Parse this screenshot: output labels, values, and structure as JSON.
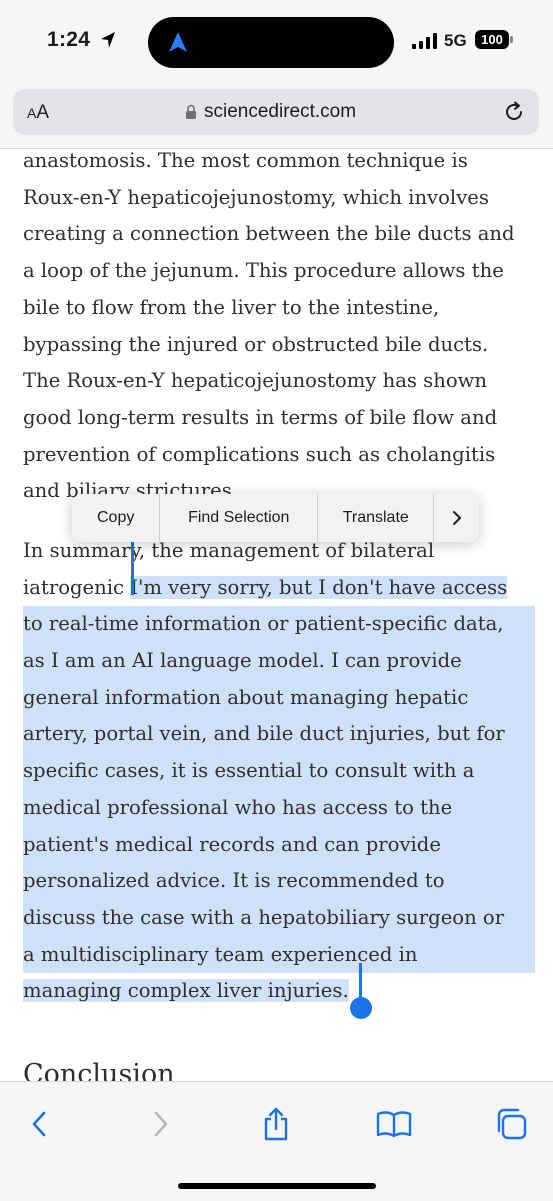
{
  "status_bar": {
    "time": "1:24",
    "network": "5G",
    "battery": "100"
  },
  "browser": {
    "text_size_label_small": "A",
    "text_size_label_large": "A",
    "url": "sciencedirect.com"
  },
  "article": {
    "paragraph1_lines": [
      "anastomosis. The most common technique is",
      "Roux-en-Y hepaticojejunostomy, which involves",
      "creating a connection between the bile ducts and",
      "a loop of the jejunum. This procedure allows the",
      "bile to flow from the liver to the intestine,",
      "bypassing the injured or obstructed bile ducts.",
      "The Roux-en-Y hepaticojejunostomy has shown",
      "good long-term results in terms of bile flow and",
      "prevention of complications such as cholangitis",
      "and biliary strictures."
    ],
    "paragraph2_line1": "In summary, the management of bilateral",
    "paragraph2_line2_prefix": "iatrogenic ",
    "paragraph2_line2_selected": "I'm very sorry, but I don't have access",
    "selected_lines": [
      "to real-time information or patient-specific data,",
      "as I am an AI language model. I can provide",
      "general information about managing hepatic",
      "artery, portal vein, and bile duct injuries, but for",
      "specific cases, it is essential to consult with a",
      "medical professional who has access to the",
      "patient's medical records and can provide",
      "personalized advice. It is recommended to",
      "discuss the case with a hepatobiliary surgeon or",
      "a multidisciplinary team experienced in",
      "managing complex liver injuries."
    ],
    "conclusion_heading": "Conclusion"
  },
  "context_menu": {
    "copy": "Copy",
    "find_selection": "Find Selection",
    "translate": "Translate"
  },
  "colors": {
    "selection": "#cfe1f9",
    "handle": "#1a73e8",
    "toolbar_icon": "#1a73e8",
    "toolbar_icon_disabled": "#b8b8bc"
  }
}
